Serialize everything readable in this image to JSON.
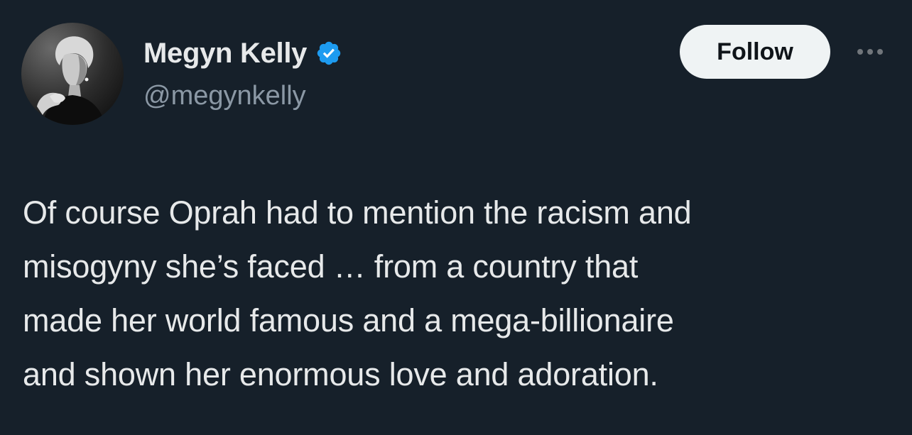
{
  "author": {
    "display_name": "Megyn Kelly",
    "handle": "@megynkelly",
    "verified": true,
    "avatar_icon": "profile-photo-avatar"
  },
  "actions": {
    "follow_label": "Follow",
    "more_icon": "more-horizontal-icon"
  },
  "tweet": {
    "lines": [
      "Of course Oprah had to mention the racism and",
      "misogyny she’s faced … from a country that",
      "made her world famous and a mega-billionaire",
      "and shown her enormous love and adoration."
    ]
  },
  "colors": {
    "background": "#16202a",
    "text_primary": "#e7e9ea",
    "text_secondary": "#8b98a5",
    "verified_blue": "#1d9bf0",
    "follow_button_bg": "#eff3f4"
  }
}
